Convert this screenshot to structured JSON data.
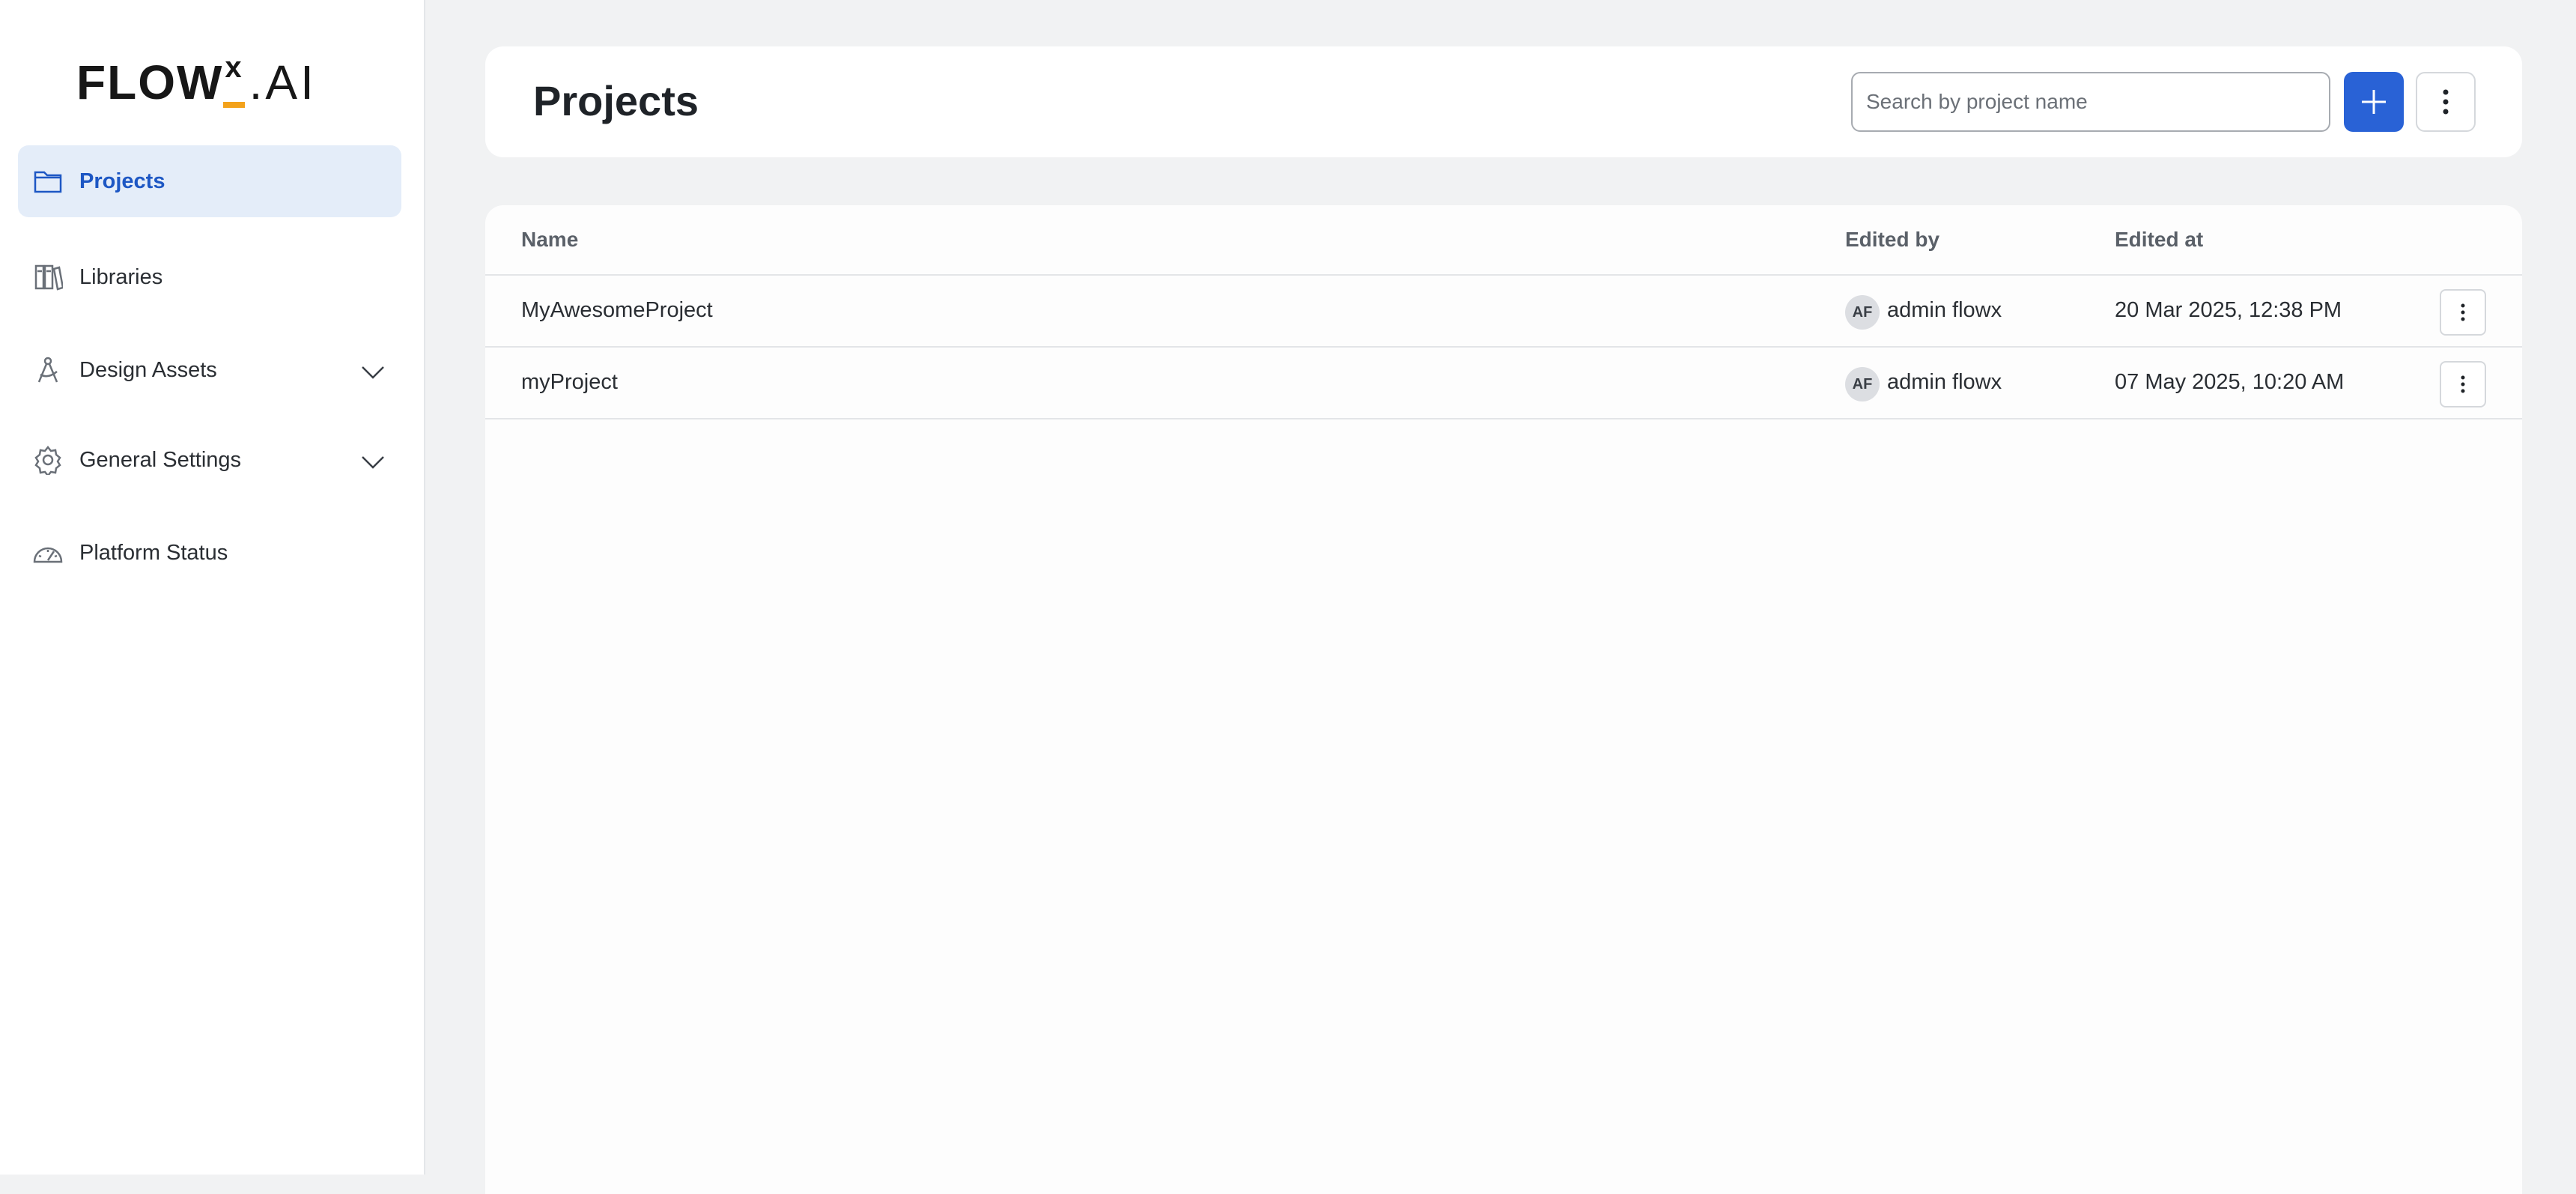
{
  "brand": {
    "logo_main": "FLOW",
    "logo_sup": "x",
    "logo_suffix": ".AI",
    "accent": "#f3a21b"
  },
  "sidebar": {
    "items": [
      {
        "label": "Projects",
        "icon": "folder-icon",
        "active": true
      },
      {
        "label": "Libraries",
        "icon": "books-icon"
      },
      {
        "label": "Design Assets",
        "icon": "compass-icon",
        "expandable": true
      },
      {
        "label": "General Settings",
        "icon": "gear-icon",
        "expandable": true
      },
      {
        "label": "Platform Status",
        "icon": "gauge-icon"
      }
    ]
  },
  "header": {
    "title": "Projects",
    "search_placeholder": "Search by project name",
    "add_icon": "plus-icon",
    "more_icon": "vertical-dots-icon",
    "primary_color": "#2962d6"
  },
  "table": {
    "columns": [
      "Name",
      "Edited by",
      "Edited at"
    ],
    "rows": [
      {
        "name": "MyAwesomeProject",
        "initials": "AF",
        "edited_by": "admin flowx",
        "edited_at": "20 Mar 2025, 12:38 PM"
      },
      {
        "name": "myProject",
        "initials": "AF",
        "edited_by": "admin flowx",
        "edited_at": "07 May 2025, 10:20 AM"
      }
    ]
  }
}
